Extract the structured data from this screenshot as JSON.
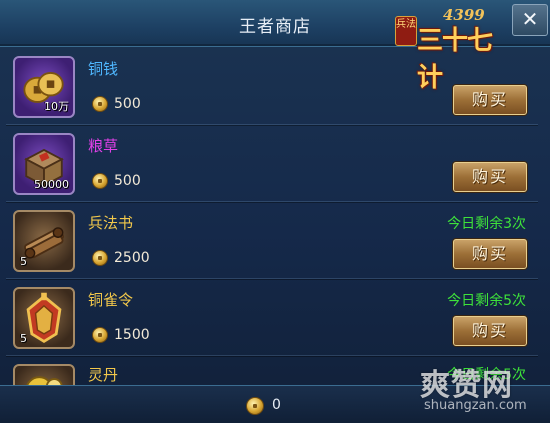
{
  "window": {
    "title": "王者商店",
    "close_label": "✕"
  },
  "logo": {
    "tag": "兵法",
    "number": "4399",
    "name": "三十七计"
  },
  "items": [
    {
      "name": "铜钱",
      "name_color": "#4fb7ff",
      "quantity": "10万",
      "price": "500",
      "limit": "",
      "buy_label": "购买",
      "slot": "purple",
      "icon": "copper-coins-icon"
    },
    {
      "name": "粮草",
      "name_color": "#e040e8",
      "quantity": "50000",
      "price": "500",
      "limit": "",
      "buy_label": "购买",
      "slot": "purple",
      "icon": "grain-crate-icon"
    },
    {
      "name": "兵法书",
      "name_color": "#f2c84b",
      "quantity": "5",
      "price": "2500",
      "limit": "今日剩余3次",
      "buy_label": "购买",
      "slot": "brown",
      "icon": "scroll-book-icon"
    },
    {
      "name": "铜雀令",
      "name_color": "#f2c84b",
      "quantity": "5",
      "price": "1500",
      "limit": "今日剩余5次",
      "buy_label": "购买",
      "slot": "brown",
      "icon": "bronze-token-icon"
    },
    {
      "name": "灵丹",
      "name_color": "#f2c84b",
      "quantity": "",
      "price": "",
      "limit": "今日剩余5次",
      "buy_label": "",
      "slot": "brown",
      "icon": "elixir-pill-icon"
    }
  ],
  "footer": {
    "currency_icon": "coin-icon",
    "total": "0"
  },
  "watermark": {
    "text": "爽赞网",
    "url": "shuangzan.com"
  },
  "colors": {
    "limit_green": "#3ee23a",
    "title_text": "#e7eef6"
  }
}
